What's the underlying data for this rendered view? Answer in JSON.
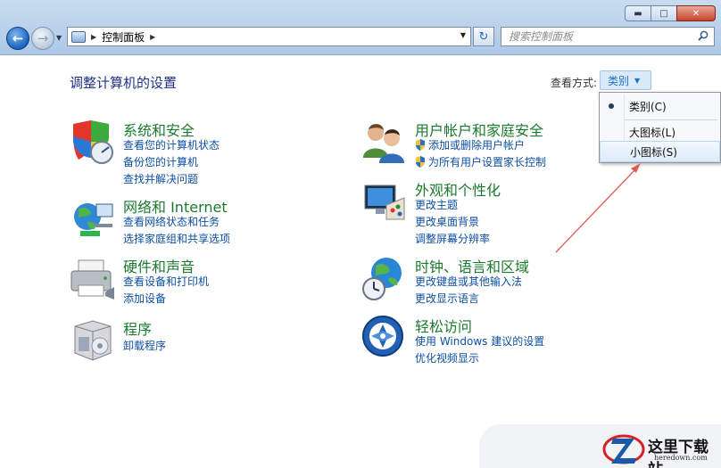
{
  "window": {
    "min_glyph": "▬",
    "max_glyph": "□",
    "close_glyph": "✕"
  },
  "nav": {
    "back_glyph": "←",
    "forward_glyph": "→",
    "drop_glyph": "▼"
  },
  "address": {
    "separator": "▶",
    "segment": "控制面板",
    "trailing_separator": "▶",
    "dropdown_glyph": "▼"
  },
  "refresh_glyph": "↻",
  "search": {
    "placeholder": "搜索控制面板"
  },
  "content": {
    "title": "调整计算机的设置",
    "view_label": "查看方式:",
    "view_value": "类别",
    "view_caret": "▼"
  },
  "view_menu": {
    "items": [
      {
        "label": "类别(C)",
        "selected": true
      },
      {
        "label": "大图标(L)"
      },
      {
        "label": "小图标(S)"
      }
    ]
  },
  "categories": [
    {
      "title": "系统和安全",
      "links": [
        "查看您的计算机状态",
        "备份您的计算机",
        "查找并解决问题"
      ]
    },
    {
      "title": "网络和 Internet",
      "links": [
        "查看网络状态和任务",
        "选择家庭组和共享选项"
      ]
    },
    {
      "title": "硬件和声音",
      "links": [
        "查看设备和打印机",
        "添加设备"
      ]
    },
    {
      "title": "程序",
      "links": [
        "卸载程序"
      ]
    },
    {
      "title": "用户帐户和家庭安全",
      "links": [
        "添加或删除用户帐户",
        "为所有用户设置家长控制"
      ]
    },
    {
      "title": "外观和个性化",
      "links": [
        "更改主题",
        "更改桌面背景",
        "调整屏幕分辨率"
      ]
    },
    {
      "title": "时钟、语言和区域",
      "links": [
        "更改键盘或其他输入法",
        "更改显示语言"
      ]
    },
    {
      "title": "轻松访问",
      "links": [
        "使用 Windows 建议的设置",
        "优化视频显示"
      ]
    }
  ],
  "watermark": {
    "text": "这里下载站",
    "sub": "heredown.com"
  },
  "colors": {
    "category_title": "#1a7a2e",
    "link": "#0d4fa3",
    "title": "#1e3287",
    "annotation_arrow": "#e05a5a"
  }
}
